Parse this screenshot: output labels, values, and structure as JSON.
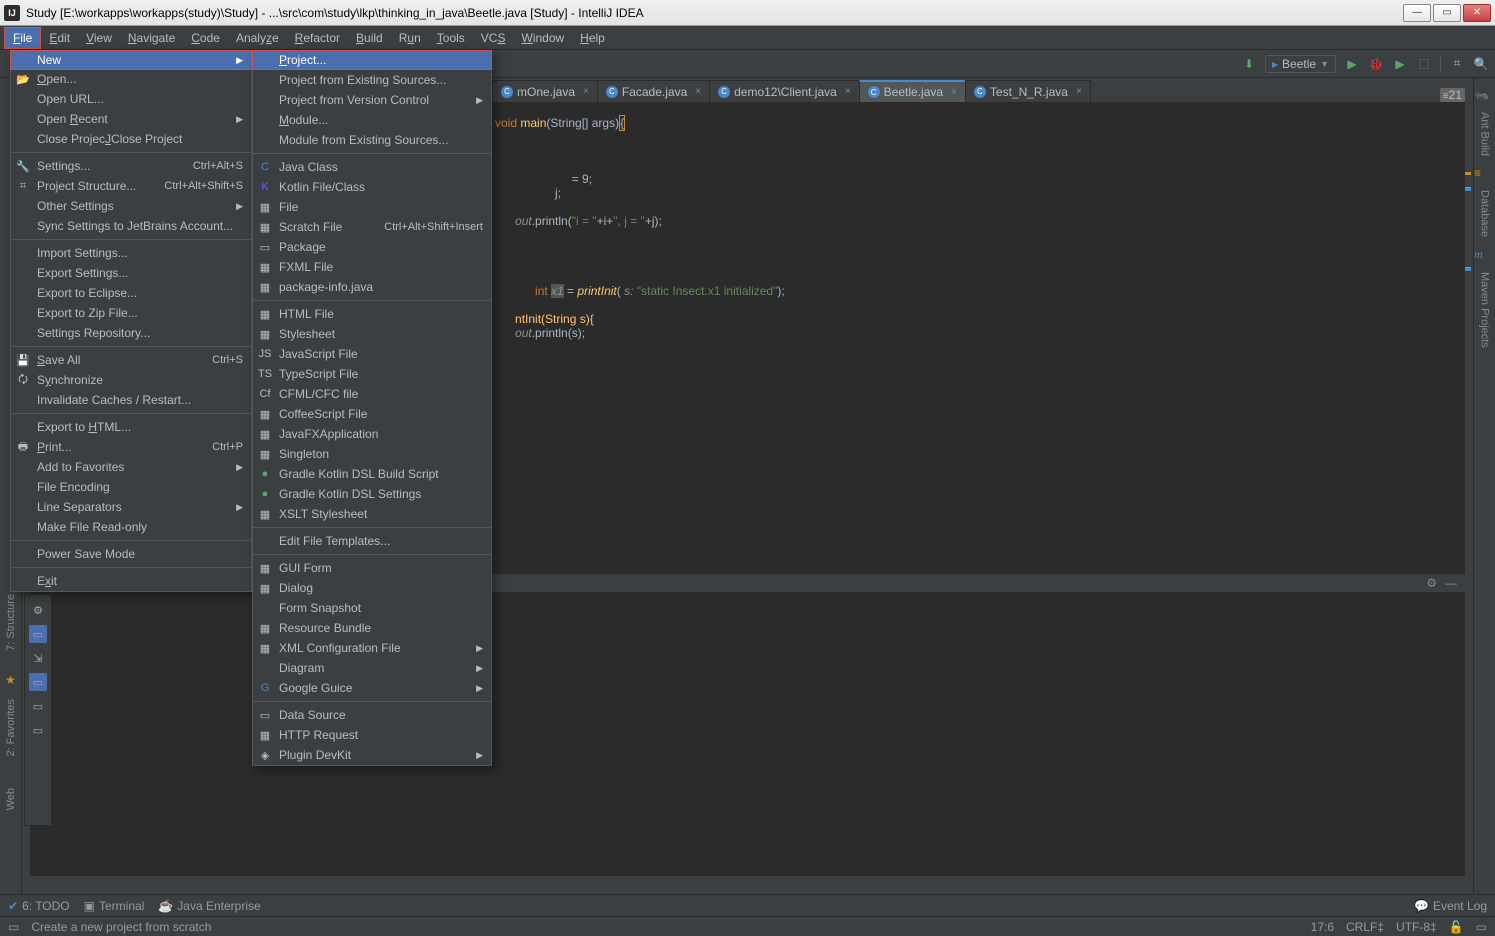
{
  "window": {
    "title": "Study [E:\\workapps\\workapps(study)\\Study] - ...\\src\\com\\study\\lkp\\thinking_in_java\\Beetle.java [Study] - IntelliJ IDEA"
  },
  "menubar": [
    "File",
    "Edit",
    "View",
    "Navigate",
    "Code",
    "Analyze",
    "Refactor",
    "Build",
    "Run",
    "Tools",
    "VCS",
    "Window",
    "Help"
  ],
  "run_config": {
    "name": "Beetle"
  },
  "editor_tabs": [
    {
      "name": "mOne.java",
      "active": false,
      "partial": true
    },
    {
      "name": "Facade.java",
      "active": false
    },
    {
      "name": "demo12\\Client.java",
      "active": false
    },
    {
      "name": "Beetle.java",
      "active": true
    },
    {
      "name": "Test_N_R.java",
      "active": false
    }
  ],
  "tabs_overflow": "21",
  "file_menu": {
    "items": [
      {
        "label": "New",
        "type": "submenu",
        "highlighted": true,
        "boxed": true
      },
      {
        "label": "Open...",
        "icon": "📂",
        "ul": "O"
      },
      {
        "label": "Open URL..."
      },
      {
        "label": "Open Recent",
        "type": "submenu",
        "ul": "R"
      },
      {
        "label": "Close Project",
        "ul": "J"
      },
      {
        "type": "sep"
      },
      {
        "label": "Settings...",
        "icon": "🔧",
        "shortcut": "Ctrl+Alt+S"
      },
      {
        "label": "Project Structure...",
        "icon": "⌗",
        "shortcut": "Ctrl+Alt+Shift+S"
      },
      {
        "label": "Other Settings",
        "type": "submenu"
      },
      {
        "label": "Sync Settings to JetBrains Account..."
      },
      {
        "type": "sep"
      },
      {
        "label": "Import Settings..."
      },
      {
        "label": "Export Settings..."
      },
      {
        "label": "Export to Eclipse..."
      },
      {
        "label": "Export to Zip File..."
      },
      {
        "label": "Settings Repository..."
      },
      {
        "type": "sep"
      },
      {
        "label": "Save All",
        "icon": "💾",
        "shortcut": "Ctrl+S",
        "ul": "S"
      },
      {
        "label": "Synchronize",
        "icon": "🗘",
        "ul": "y"
      },
      {
        "label": "Invalidate Caches / Restart..."
      },
      {
        "type": "sep"
      },
      {
        "label": "Export to HTML...",
        "ul": "H"
      },
      {
        "label": "Print...",
        "icon": "🖶",
        "shortcut": "Ctrl+P",
        "ul": "P"
      },
      {
        "label": "Add to Favorites",
        "type": "submenu"
      },
      {
        "label": "File Encoding"
      },
      {
        "label": "Line Separators",
        "type": "submenu"
      },
      {
        "label": "Make File Read-only"
      },
      {
        "type": "sep"
      },
      {
        "label": "Power Save Mode"
      },
      {
        "type": "sep"
      },
      {
        "label": "Exit",
        "ul": "x"
      }
    ]
  },
  "new_submenu": {
    "items": [
      {
        "label": "Project...",
        "highlighted": true,
        "boxed": true,
        "ul": "P"
      },
      {
        "label": "Project from Existing Sources..."
      },
      {
        "label": "Project from Version Control",
        "type": "submenu"
      },
      {
        "label": "Module...",
        "ul": "M"
      },
      {
        "label": "Module from Existing Sources..."
      },
      {
        "type": "sep"
      },
      {
        "label": "Java Class",
        "icon": "C",
        "iconcolor": "#4a88c7"
      },
      {
        "label": "Kotlin File/Class",
        "icon": "K",
        "iconcolor": "#7f52ff"
      },
      {
        "label": "File",
        "icon": "▦"
      },
      {
        "label": "Scratch File",
        "icon": "▦",
        "shortcut": "Ctrl+Alt+Shift+Insert"
      },
      {
        "label": "Package",
        "icon": "▭"
      },
      {
        "label": "FXML File",
        "icon": "▦"
      },
      {
        "label": "package-info.java",
        "icon": "▦"
      },
      {
        "type": "sep"
      },
      {
        "label": "HTML File",
        "icon": "▦"
      },
      {
        "label": "Stylesheet",
        "icon": "▦"
      },
      {
        "label": "JavaScript File",
        "icon": "JS"
      },
      {
        "label": "TypeScript File",
        "icon": "TS"
      },
      {
        "label": "CFML/CFC file",
        "icon": "Cf"
      },
      {
        "label": "CoffeeScript File",
        "icon": "▦"
      },
      {
        "label": "JavaFXApplication",
        "icon": "▦"
      },
      {
        "label": "Singleton",
        "icon": "▦"
      },
      {
        "label": "Gradle Kotlin DSL Build Script",
        "icon": "●",
        "iconcolor": "#59a869"
      },
      {
        "label": "Gradle Kotlin DSL Settings",
        "icon": "●",
        "iconcolor": "#59a869"
      },
      {
        "label": "XSLT Stylesheet",
        "icon": "▦"
      },
      {
        "type": "sep"
      },
      {
        "label": "Edit File Templates..."
      },
      {
        "type": "sep"
      },
      {
        "label": "GUI Form",
        "icon": "▦"
      },
      {
        "label": "Dialog",
        "icon": "▦"
      },
      {
        "label": "Form Snapshot"
      },
      {
        "label": "Resource Bundle",
        "icon": "▦"
      },
      {
        "label": "XML Configuration File",
        "type": "submenu",
        "icon": "▦"
      },
      {
        "label": "Diagram",
        "type": "submenu"
      },
      {
        "label": "Google Guice",
        "type": "submenu",
        "icon": "G",
        "iconcolor": "#4a88c7"
      },
      {
        "type": "sep"
      },
      {
        "label": "Data Source",
        "icon": "▭"
      },
      {
        "label": "HTTP Request",
        "icon": "▦"
      },
      {
        "label": "Plugin DevKit",
        "type": "submenu",
        "icon": "◈"
      }
    ]
  },
  "left_tools": [
    {
      "label": "7: Structure"
    },
    {
      "label": "2: Favorites"
    },
    {
      "label": "Web"
    }
  ],
  "right_tools": [
    {
      "label": "Ant Build"
    },
    {
      "label": "Database"
    },
    {
      "label": "Maven Projects"
    }
  ],
  "event_log_title": "Event Log",
  "bottom_tools": [
    {
      "label": "6: TODO",
      "icon": "✔"
    },
    {
      "label": "Terminal",
      "icon": "▣"
    },
    {
      "label": "Java Enterprise",
      "icon": "☕"
    }
  ],
  "bottom_right": "Event Log",
  "status": {
    "hint": "Create a new project from scratch",
    "pos": "17:6",
    "lineend": "CRLF‡",
    "encoding": "UTF-8‡"
  },
  "code": {
    "line1_pre": "void ",
    "line1_method": "main",
    "line1_args": "(String[] args)",
    "line1_brace": "{",
    "line3": " = 9;",
    "line4": "j;",
    "line5_a": ".println(",
    "line5_str": "\"i = \"",
    "line5_b": "+i+",
    "line5_str2": "\", j = \"",
    "line5_c": "+j);",
    "line7_a": " int ",
    "line7_var": "x1",
    "line7_b": " = ",
    "line7_call": "printInit",
    "line7_c": "( ",
    "line7_hint": "s:",
    "line7_str": " \"static Insect.x1 initialized\"",
    "line7_d": ");",
    "line8_a": "ntInit(String s){",
    "line9_a": ".println(s);"
  }
}
